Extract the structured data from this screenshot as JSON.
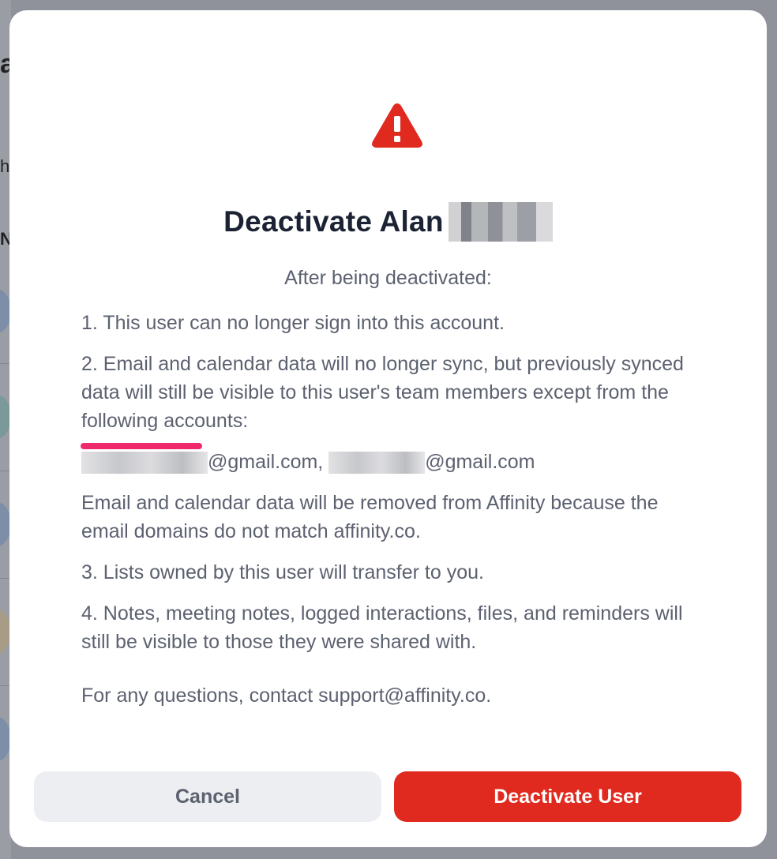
{
  "background": {
    "partial_chars": [
      "a",
      "h",
      "N"
    ]
  },
  "dialog": {
    "icon": "warning-triangle-icon",
    "title": "Deactivate Alan",
    "subtitle": "After being deactivated:",
    "item1": "1. This user can no longer sign into this account.",
    "item2": "2. Email and calendar data will no longer sync, but previously synced data will still be visible to this user's team members except from the following accounts:",
    "accounts": {
      "email1_suffix": "@gmail.com,",
      "email2_suffix": "@gmail.com"
    },
    "removal_note": "Email and calendar data will be removed from Affinity because the email domains do not match affinity.co.",
    "item3": "3. Lists owned by this user will transfer to you.",
    "item4": "4. Notes, meeting notes, logged interactions, files, and reminders will still be visible to those they were shared with.",
    "contact": "For any questions, contact support@affinity.co.",
    "cancel_label": "Cancel",
    "deactivate_label": "Deactivate User"
  },
  "colors": {
    "danger": "#e02a1f",
    "highlight_underline": "#ee2a6c",
    "title": "#1b2233",
    "body": "#5c6170"
  }
}
